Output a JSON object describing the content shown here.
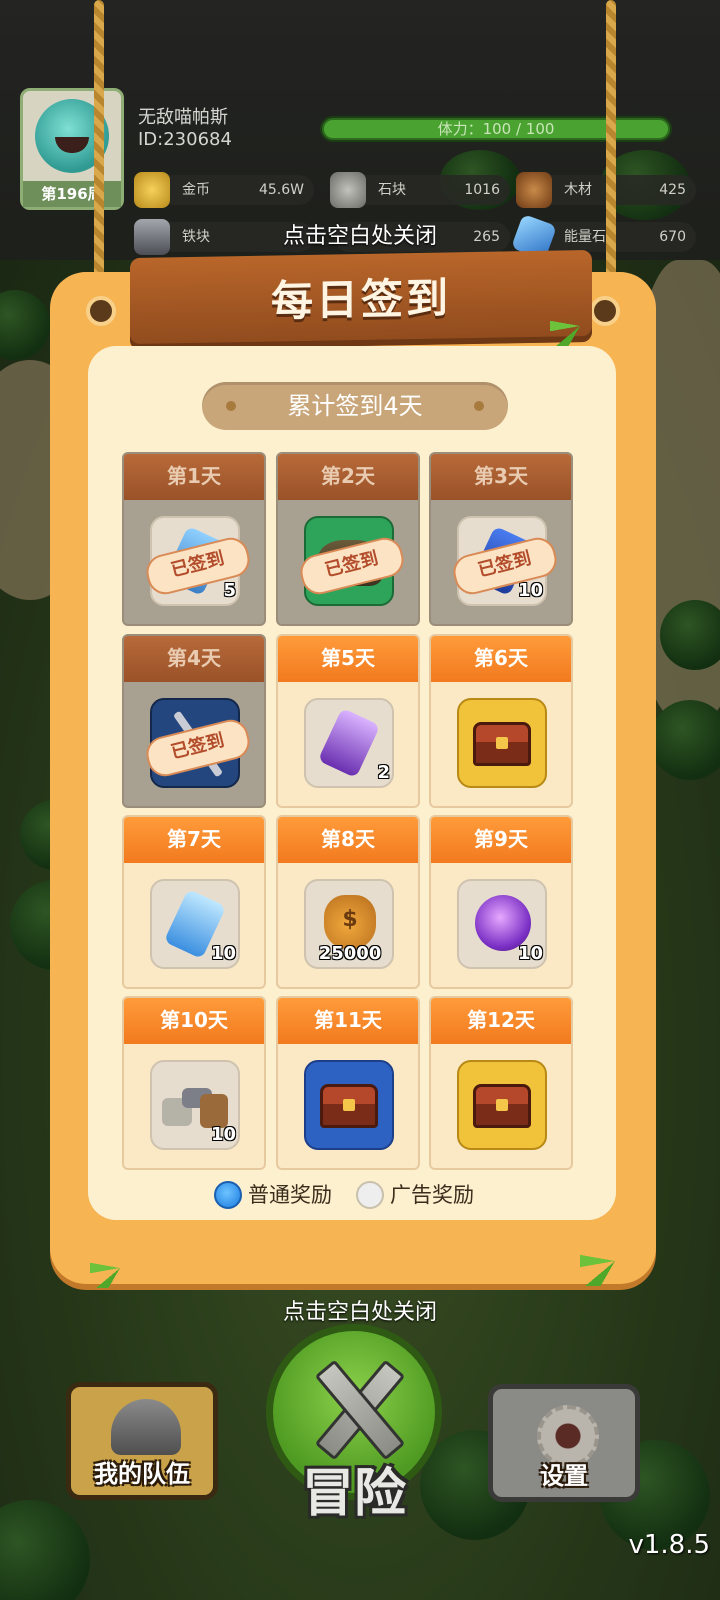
{
  "player": {
    "name": "无敌喵帕斯",
    "id": "ID:230684",
    "rank": "第196周"
  },
  "stamina": {
    "label": "体力：100 / 100",
    "percent": 100
  },
  "resources": [
    {
      "name": "金币",
      "value": "45.6W",
      "icon": "gold-coins-icon",
      "color": "#e7b53a"
    },
    {
      "name": "石块",
      "value": "1016",
      "icon": "stone-icon",
      "color": "#9a9a94"
    },
    {
      "name": "木材",
      "value": "425",
      "icon": "wood-icon",
      "color": "#a0602c"
    },
    {
      "name": "铁块",
      "value": "",
      "icon": "iron-ingot-icon",
      "color": "#7c7e86"
    },
    {
      "name": "",
      "value": "265",
      "icon": "",
      "color": ""
    },
    {
      "name": "能量石",
      "value": "670",
      "icon": "energy-stone-icon",
      "color": "#4aa0e8"
    }
  ],
  "close_hint_top": "点击空白处关闭",
  "dialog": {
    "title": "每日签到",
    "streak": "累计签到4天",
    "claimed_stamp": "已签到",
    "days": [
      {
        "label": "第1天",
        "claimed": true,
        "item": "crystal-sword-icon",
        "qty": "5"
      },
      {
        "label": "第2天",
        "claimed": true,
        "item": "stone-block-icon",
        "qty": ""
      },
      {
        "label": "第3天",
        "claimed": true,
        "item": "blue-gem-icon",
        "qty": "10"
      },
      {
        "label": "第4天",
        "claimed": true,
        "item": "sword-card-icon",
        "qty": ""
      },
      {
        "label": "第5天",
        "claimed": false,
        "item": "purple-crystal-icon",
        "qty": "2"
      },
      {
        "label": "第6天",
        "claimed": false,
        "item": "gold-chest-icon",
        "qty": "",
        "grade": "A"
      },
      {
        "label": "第7天",
        "claimed": false,
        "item": "energy-stone-icon",
        "qty": "10"
      },
      {
        "label": "第8天",
        "claimed": false,
        "item": "money-bag-icon",
        "qty": "25000"
      },
      {
        "label": "第9天",
        "claimed": false,
        "item": "purple-orb-icon",
        "qty": "10"
      },
      {
        "label": "第10天",
        "claimed": false,
        "item": "materials-bundle-icon",
        "qty": "10"
      },
      {
        "label": "第11天",
        "claimed": false,
        "item": "blue-chest-icon",
        "qty": "",
        "grade": "C"
      },
      {
        "label": "第12天",
        "claimed": false,
        "item": "gold-chest-icon",
        "qty": "",
        "grade": "A"
      }
    ],
    "reward_modes": [
      {
        "label": "普通奖励",
        "selected": true
      },
      {
        "label": "广告奖励",
        "selected": false
      }
    ]
  },
  "close_hint_bottom": "点击空白处关闭",
  "nav": {
    "team": "我的队伍",
    "adventure": "冒险",
    "settings": "设置"
  },
  "version": "v1.8.5"
}
